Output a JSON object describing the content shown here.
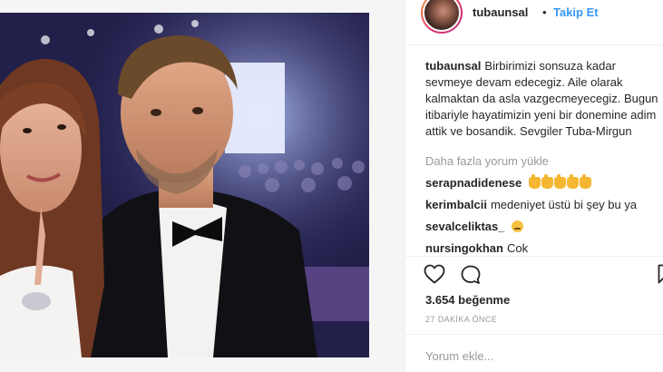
{
  "header": {
    "username": "tubaunsal",
    "separator": "•",
    "follow_label": "Takip Et"
  },
  "caption": {
    "username": "tubaunsal",
    "text": "Birbirimizi sonsuza kadar sevmeye devam edecegiz. Aile olarak kalmaktan da asla vazgecmeyecegiz. Bugun itibariyle hayatimizin yeni bir donemine adim attik ve bosandik. Sevgiler Tuba-Mirgun"
  },
  "load_more_label": "Daha fazla yorum yükle",
  "comments": [
    {
      "username": "serapnadidenese",
      "text": "",
      "emoji": "clap-hands-x5"
    },
    {
      "username": "kerimbalcii",
      "text": "medeniyet üstü bi şey bu ya",
      "emoji": ""
    },
    {
      "username": "sevalceliktas_",
      "text": "",
      "emoji": "sad-face"
    },
    {
      "username": "nursingokhan",
      "text": "Cok",
      "emoji": ""
    }
  ],
  "actions": {
    "like_icon": "heart-icon",
    "comment_icon": "comment-bubble-icon",
    "save_icon": "bookmark-icon"
  },
  "likes_label": "3.654 beğenme",
  "timestamp": "27 DAKİKA ÖNCE",
  "comment_input": {
    "placeholder": "Yorum ekle..."
  },
  "colors": {
    "link": "#3897f0",
    "text": "#262626",
    "muted": "#999999",
    "border": "#efefef"
  }
}
